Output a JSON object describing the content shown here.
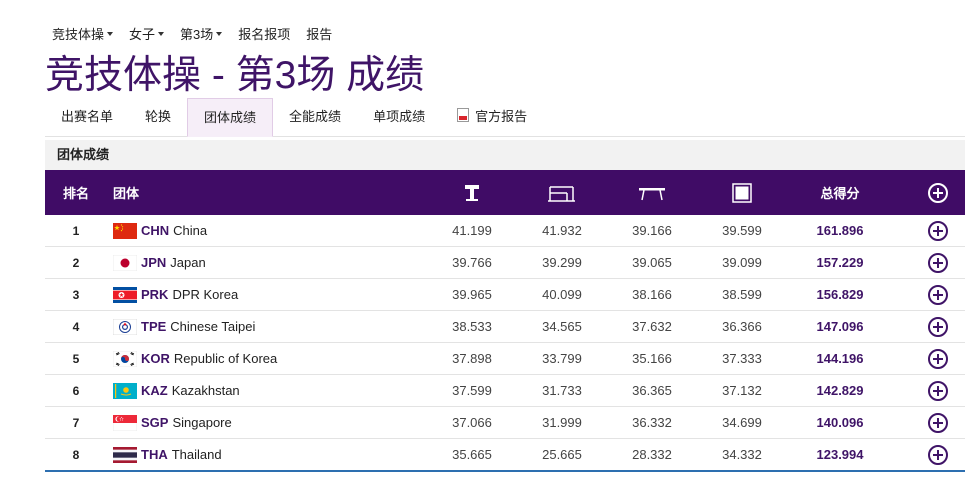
{
  "topnav": {
    "items": [
      {
        "label": "竞技体操",
        "has_caret": true
      },
      {
        "label": "女子",
        "has_caret": true
      },
      {
        "label": "第3场",
        "has_caret": true
      },
      {
        "label": "报名报项",
        "has_caret": false
      },
      {
        "label": "报告",
        "has_caret": false
      }
    ]
  },
  "page_title": "竞技体操 - 第3场 成绩",
  "tabs": [
    {
      "label": "出赛名单",
      "active": false
    },
    {
      "label": "轮换",
      "active": false
    },
    {
      "label": "团体成绩",
      "active": true
    },
    {
      "label": "全能成绩",
      "active": false
    },
    {
      "label": "单项成绩",
      "active": false
    },
    {
      "label": "官方报告",
      "active": false,
      "icon": "pdf-icon"
    }
  ],
  "section_title": "团体成绩",
  "table": {
    "headers": {
      "rank": "排名",
      "team": "团体",
      "vault_icon": "vault-icon",
      "uneven_bars_icon": "uneven-bars-icon",
      "beam_icon": "balance-beam-icon",
      "floor_icon": "floor-exercise-icon",
      "total": "总得分",
      "expand_icon": "plus-circle-icon"
    },
    "rows": [
      {
        "rank": "1",
        "code": "CHN",
        "name": "China",
        "flag": "flag-chn",
        "scores": [
          "41.199",
          "41.932",
          "39.166",
          "39.599"
        ],
        "total": "161.896"
      },
      {
        "rank": "2",
        "code": "JPN",
        "name": "Japan",
        "flag": "flag-jpn",
        "scores": [
          "39.766",
          "39.299",
          "39.065",
          "39.099"
        ],
        "total": "157.229"
      },
      {
        "rank": "3",
        "code": "PRK",
        "name": "DPR Korea",
        "flag": "flag-prk",
        "scores": [
          "39.965",
          "40.099",
          "38.166",
          "38.599"
        ],
        "total": "156.829"
      },
      {
        "rank": "4",
        "code": "TPE",
        "name": "Chinese Taipei",
        "flag": "flag-tpe",
        "scores": [
          "38.533",
          "34.565",
          "37.632",
          "36.366"
        ],
        "total": "147.096"
      },
      {
        "rank": "5",
        "code": "KOR",
        "name": "Republic of Korea",
        "flag": "flag-kor",
        "scores": [
          "37.898",
          "33.799",
          "35.166",
          "37.333"
        ],
        "total": "144.196"
      },
      {
        "rank": "6",
        "code": "KAZ",
        "name": "Kazakhstan",
        "flag": "flag-kaz",
        "scores": [
          "37.599",
          "31.733",
          "36.365",
          "37.132"
        ],
        "total": "142.829"
      },
      {
        "rank": "7",
        "code": "SGP",
        "name": "Singapore",
        "flag": "flag-sgp",
        "scores": [
          "37.066",
          "31.999",
          "36.332",
          "34.699"
        ],
        "total": "140.096"
      },
      {
        "rank": "8",
        "code": "THA",
        "name": "Thailand",
        "flag": "flag-tha",
        "scores": [
          "35.665",
          "25.665",
          "28.332",
          "34.332"
        ],
        "total": "123.994"
      }
    ]
  },
  "colors": {
    "brand_purple": "#400c66",
    "title_purple": "#3f1467",
    "active_tab_bg": "#f6eef8"
  }
}
